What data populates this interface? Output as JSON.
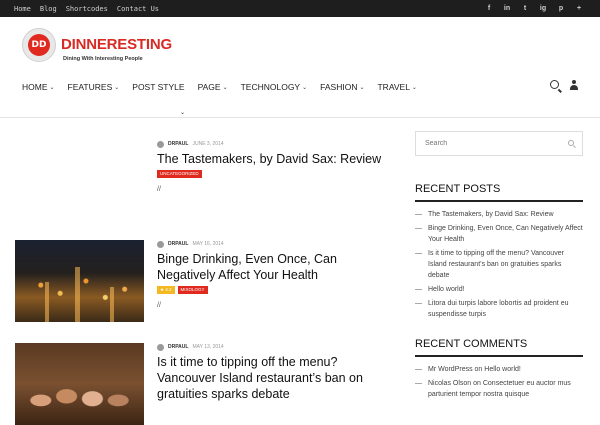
{
  "topbar": {
    "links": [
      "Home",
      "Blog",
      "Shortcodes",
      "Contact Us"
    ],
    "social": [
      "f",
      "in",
      "t",
      "ig",
      "p",
      "+"
    ]
  },
  "logo": {
    "mark": "DD",
    "name": "DINNERESTING",
    "tagline": "Dining With Interesting People"
  },
  "nav": {
    "items": [
      {
        "label": "HOME",
        "dropdown": true
      },
      {
        "label": "FEATURES",
        "dropdown": true
      },
      {
        "label": "POST STYLE",
        "dropdown": false
      },
      {
        "label": "PAGE",
        "dropdown": true
      },
      {
        "label": "TECHNOLOGY",
        "dropdown": true
      },
      {
        "label": "FASHION",
        "dropdown": true
      },
      {
        "label": "TRAVEL",
        "dropdown": true
      }
    ],
    "icons": [
      "search-icon",
      "user-icon"
    ]
  },
  "posts": [
    {
      "author": "DRPAUL",
      "date": "JUNE 3, 2014",
      "title": "The Tastemakers, by David Sax: Review",
      "tags": [
        "UNCATEGORIZED"
      ],
      "excerpt": "//"
    },
    {
      "author": "DRPAUL",
      "date": "MAY 16, 2014",
      "title": "Binge Drinking, Even Once, Can Negatively Affect Your Health",
      "rating": "★ 4.2",
      "tags": [
        "MIXOLOGY"
      ],
      "excerpt": "//"
    },
    {
      "author": "DRPAUL",
      "date": "MAY 13, 2014",
      "title": "Is it time to tipping off the menu? Vancouver Island restaurant’s ban on gratuities sparks debate"
    }
  ],
  "sidebar": {
    "search_placeholder": "Search",
    "recent_posts_title": "RECENT POSTS",
    "recent_posts": [
      "The Tastemakers, by David Sax: Review",
      "Binge Drinking, Even Once, Can Negatively Affect Your Health",
      "Is it time to tipping off the menu? Vancouver Island restaurant’s ban on gratuities sparks debate",
      "Hello world!",
      "Litora dui turpis labore lobortis ad proident eu suspendisse turpis"
    ],
    "recent_comments_title": "RECENT COMMENTS",
    "recent_comments": [
      "Mr WordPress on Hello world!",
      "Nicolas Olson on Consectetuer eu auctor mus parturient tempor nostra quisque"
    ]
  },
  "colors": {
    "brand": "#d92b25",
    "tag": "#e02a20",
    "rating": "#f4b820",
    "topbar": "#1e1e1e"
  }
}
